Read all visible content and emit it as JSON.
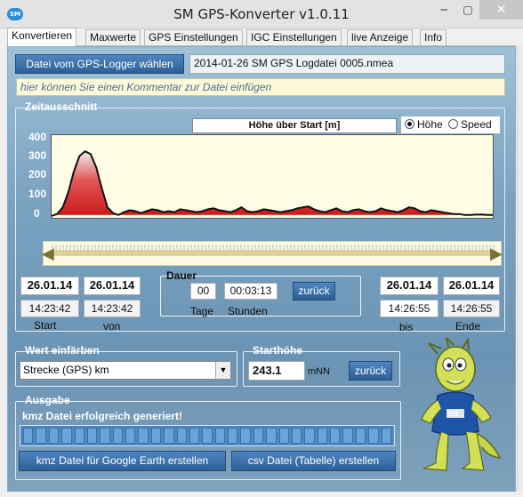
{
  "window": {
    "title": "SM GPS-Konverter v1.0.11",
    "min": "─",
    "max": "▢",
    "close": "✕",
    "icon_text": "SM"
  },
  "tabs": [
    "Konvertieren",
    "Maxwerte",
    "GPS Einstellungen",
    "IGC Einstellungen",
    "live Anzeige",
    "Info"
  ],
  "file": {
    "button": "Datei vom GPS-Logger wählen",
    "name": "2014-01-26 SM GPS Logdatei 0005.nmea"
  },
  "comment_placeholder": "hier können Sie einen Kommentar zur Datei einfügen",
  "zeitausschnitt": {
    "label": "Zeitausschnitt",
    "chart_title": "Höhe über Start [m]",
    "radio_hoehe": "Höhe",
    "radio_speed": "Speed",
    "selected": "Höhe"
  },
  "chart_data": {
    "type": "area",
    "title": "Höhe über Start [m]",
    "yticks": [
      "400",
      "300",
      "200",
      "100",
      "0"
    ],
    "ylim": [
      -15,
      420
    ],
    "color": "#cc1a1a",
    "series": [
      {
        "values": [
          -5,
          5,
          40,
          120,
          230,
          310,
          335,
          320,
          250,
          140,
          40,
          10,
          0,
          15,
          25,
          20,
          10,
          20,
          30,
          25,
          15,
          20,
          15,
          30,
          25,
          20,
          15,
          20,
          30,
          35,
          25,
          20,
          15,
          25,
          40,
          20,
          15,
          20,
          30,
          25,
          20,
          15,
          20,
          25,
          35,
          40,
          45,
          30,
          20,
          15,
          25,
          35,
          20,
          15,
          25,
          30,
          20,
          15,
          20,
          35,
          25,
          20,
          15,
          25,
          40,
          35,
          20,
          15,
          25,
          20,
          15,
          10,
          5,
          5,
          0,
          0,
          2,
          3,
          0,
          0
        ]
      }
    ]
  },
  "start": {
    "date": "26.01.14",
    "time": "14:23:42",
    "label": "Start"
  },
  "von": {
    "date": "26.01.14",
    "time": "14:23:42",
    "label": "von"
  },
  "dauer": {
    "label": "Dauer",
    "tage": "00",
    "stunden": "00:03:13",
    "tage_label": "Tage",
    "stunden_label": "Stunden",
    "button": "zurück"
  },
  "bis": {
    "date": "26.01.14",
    "time": "14:26:55",
    "label": "bis"
  },
  "ende": {
    "date": "26.01.14",
    "time": "14:26:55",
    "label": "Ende"
  },
  "wert": {
    "label": "Wert einfärben",
    "selected": "Strecke (GPS) km"
  },
  "starthoehe": {
    "label": "Starthöhe",
    "value": "243.1",
    "unit": "mNN",
    "button": "zurück"
  },
  "ausgabe": {
    "label": "Ausgabe",
    "status": "kmz Datei erfolgreich generiert!",
    "progress": 1.0,
    "kmz_button": "kmz Datei für Google Earth erstellen",
    "csv_button": "csv Datei (Tabelle) erstellen"
  },
  "mascot": {
    "shirt_text": "SM"
  }
}
